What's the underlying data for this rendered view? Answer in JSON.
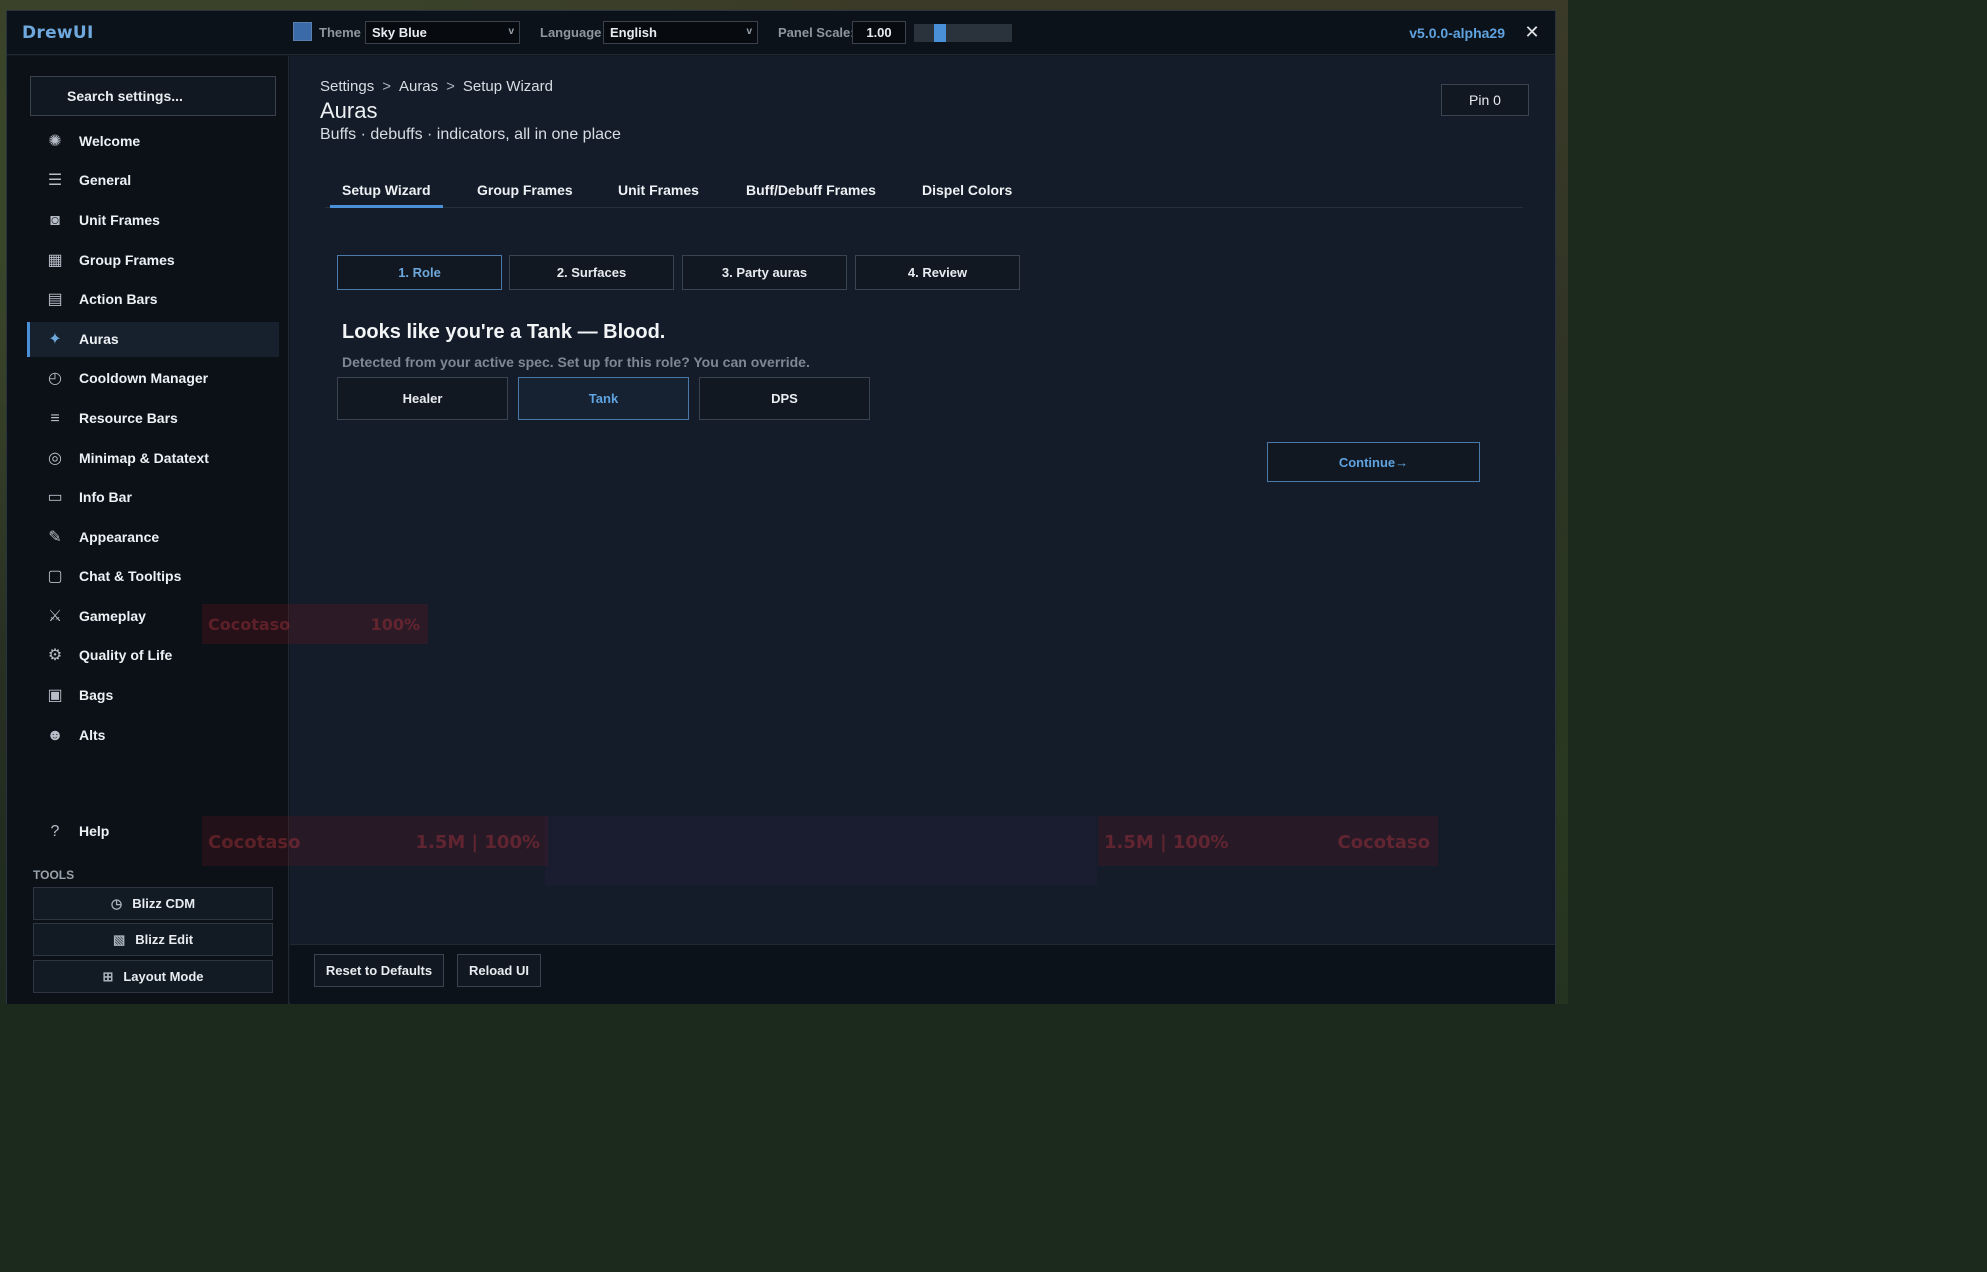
{
  "app": {
    "title": "DrewUI",
    "version": "v5.0.0-alpha29"
  },
  "topbar": {
    "theme_label": "Theme",
    "theme_value": "Sky Blue",
    "theme_color": "#3a6aa8",
    "language_label": "Language",
    "language_value": "English",
    "panel_scale_label": "Panel Scale:",
    "panel_scale_value": "1.00",
    "panel_scale_fraction": 0.23,
    "close_icon": "close-icon"
  },
  "sidebar": {
    "search_placeholder": "Search settings...",
    "items": [
      {
        "label": "Welcome",
        "icon": "compass-icon"
      },
      {
        "label": "General",
        "icon": "sliders-icon"
      },
      {
        "label": "Unit Frames",
        "icon": "portrait-icon"
      },
      {
        "label": "Group Frames",
        "icon": "group-grid-icon"
      },
      {
        "label": "Action Bars",
        "icon": "action-bars-icon"
      },
      {
        "label": "Auras",
        "icon": "sparkle-icon",
        "active": true
      },
      {
        "label": "Cooldown Manager",
        "icon": "timer-icon"
      },
      {
        "label": "Resource Bars",
        "icon": "list-bars-icon"
      },
      {
        "label": "Minimap & Datatext",
        "icon": "minimap-icon"
      },
      {
        "label": "Info Bar",
        "icon": "info-bar-icon"
      },
      {
        "label": "Appearance",
        "icon": "brush-icon"
      },
      {
        "label": "Chat & Tooltips",
        "icon": "chat-icon"
      },
      {
        "label": "Gameplay",
        "icon": "swords-icon"
      },
      {
        "label": "Quality of Life",
        "icon": "gear-sparkle-icon"
      },
      {
        "label": "Bags",
        "icon": "bag-icon"
      },
      {
        "label": "Alts",
        "icon": "users-icon"
      }
    ],
    "help_label": "Help",
    "tools_title": "TOOLS",
    "tools": [
      {
        "label": "Blizz CDM",
        "icon": "cdm-icon"
      },
      {
        "label": "Blizz Edit",
        "icon": "edit-icon"
      },
      {
        "label": "Layout Mode",
        "icon": "layout-icon"
      }
    ]
  },
  "main": {
    "breadcrumb": [
      "Settings",
      "Auras",
      "Setup Wizard"
    ],
    "title": "Auras",
    "subtitle": "Buffs · debuffs · indicators, all in one place",
    "pin_label": "Pin 0",
    "tabs": [
      "Setup Wizard",
      "Group Frames",
      "Unit Frames",
      "Buff/Debuff Frames",
      "Dispel Colors"
    ],
    "active_tab": 0,
    "steps": [
      "1. Role",
      "2. Surfaces",
      "3. Party auras",
      "4. Review"
    ],
    "active_step": 0,
    "heading": "Looks like you're a Tank — Blood.",
    "hint": "Detected from your active spec. Set up for this role? You can override.",
    "roles": [
      "Healer",
      "Tank",
      "DPS"
    ],
    "active_role": 1,
    "continue_label": "Continue→"
  },
  "game_overlay": {
    "unit_name": "Cocotaso",
    "unit_pct": "100%",
    "health_left": "1.5M | 100%",
    "health_right": "1.5M | 100%"
  },
  "footer": {
    "reset_label": "Reset to Defaults",
    "reload_label": "Reload UI"
  },
  "colors": {
    "accent": "#4a90d8",
    "accent_text": "#5fa3e0",
    "panel_bg": "#131c28"
  }
}
